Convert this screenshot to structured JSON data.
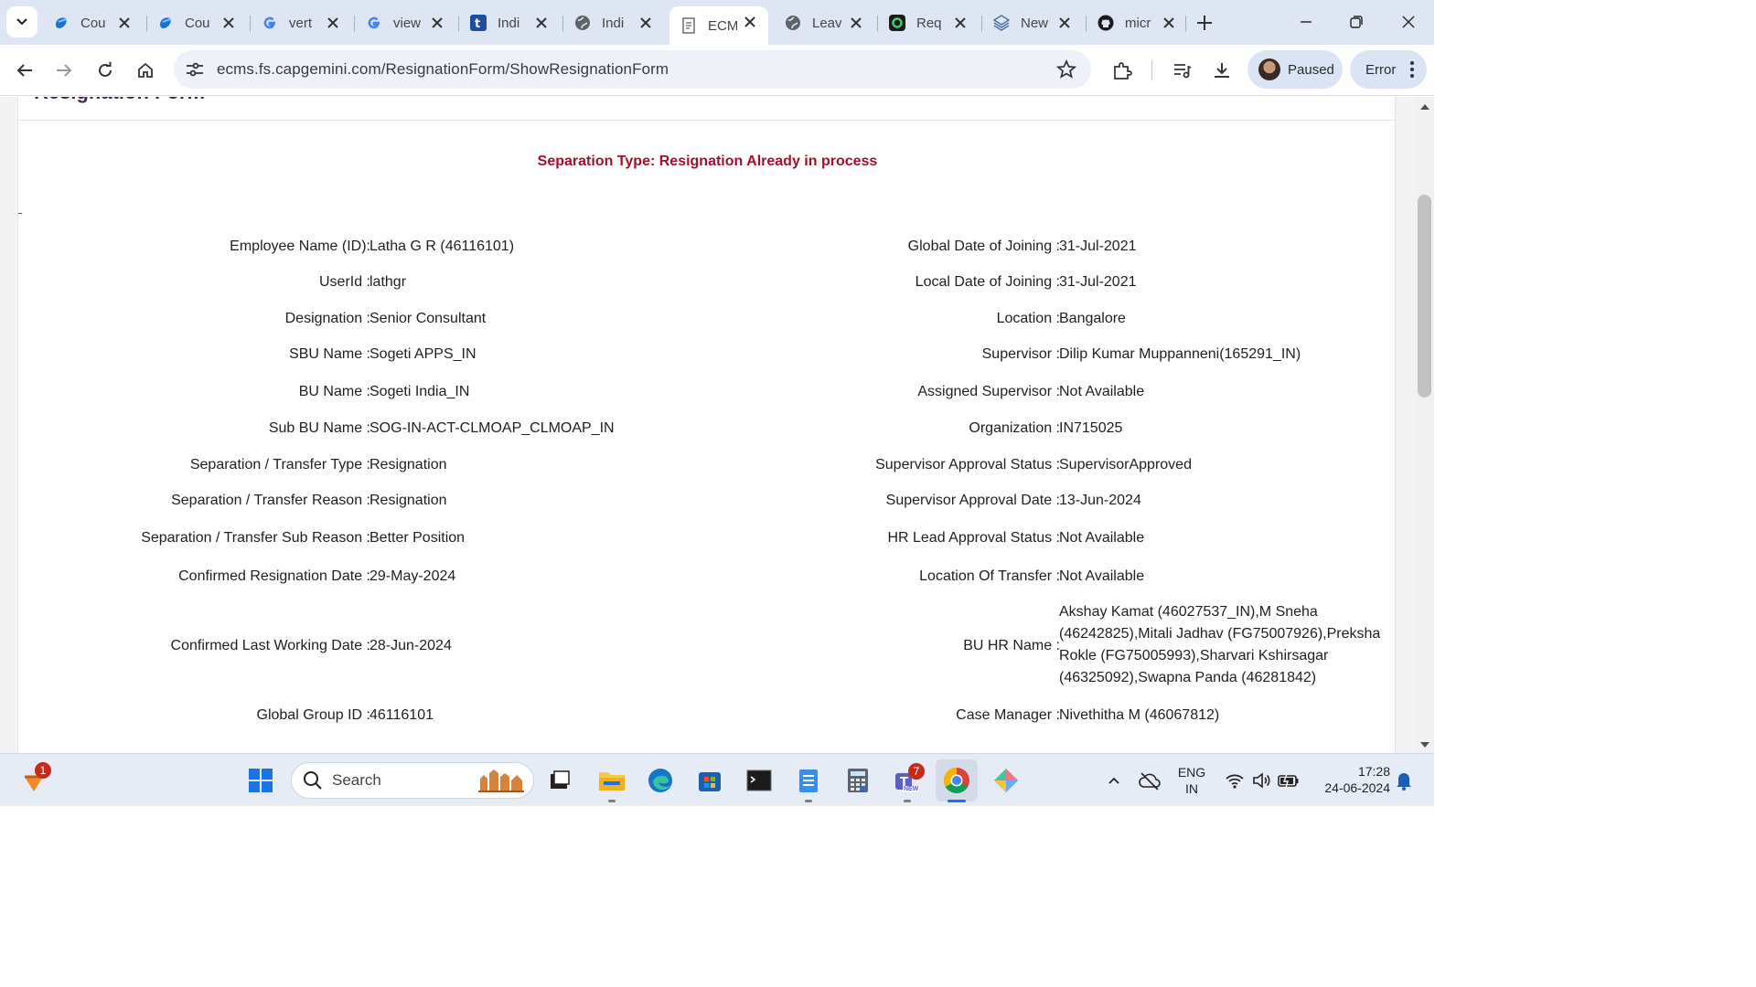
{
  "browser": {
    "tabs": [
      {
        "title": "Cou",
        "icon": "copilot-icon"
      },
      {
        "title": "Cou",
        "icon": "copilot-icon"
      },
      {
        "title": "vert",
        "icon": "google-icon"
      },
      {
        "title": "view",
        "icon": "google-icon"
      },
      {
        "title": "Indi",
        "icon": "t-app-icon"
      },
      {
        "title": "Indi",
        "icon": "globe-icon"
      },
      {
        "title": "ECM",
        "icon": "document-icon",
        "active": true
      },
      {
        "title": "Leav",
        "icon": "globe-icon"
      },
      {
        "title": "Req",
        "icon": "square-app-icon"
      },
      {
        "title": "New",
        "icon": "stack-icon"
      },
      {
        "title": "micr",
        "icon": "github-icon"
      }
    ],
    "url": "ecms.fs.capgemini.com/ResignationForm/ShowResignationForm",
    "profile_label": "Paused",
    "error_label": "Error"
  },
  "page": {
    "heading": "Resignation Form",
    "separation_type": "Separation Type: Resignation Already in process",
    "left_fields": [
      {
        "label": "Employee Name (ID):",
        "value": "Latha G R (46116101)"
      },
      {
        "label": "UserId :",
        "value": "lathgr"
      },
      {
        "label": "Designation :",
        "value": "Senior Consultant"
      },
      {
        "label": "SBU Name :",
        "value": "Sogeti APPS_IN"
      },
      {
        "label": "BU Name :",
        "value": "Sogeti India_IN"
      },
      {
        "label": "Sub BU Name :",
        "value": "SOG-IN-ACT-CLMOAP_CLMOAP_IN"
      },
      {
        "label": "Separation / Transfer Type :",
        "value": "Resignation"
      },
      {
        "label": "Separation / Transfer Reason :",
        "value": "Resignation"
      },
      {
        "label": "Separation / Transfer Sub Reason :",
        "value": "Better Position"
      },
      {
        "label": "Confirmed Resignation Date :",
        "value": "29-May-2024"
      },
      {
        "label": "Confirmed Last Working Date :",
        "value": "28-Jun-2024"
      },
      {
        "label": "Global Group ID :",
        "value": "46116101"
      }
    ],
    "right_fields": [
      {
        "label": "Global Date of Joining :",
        "value": "31-Jul-2021"
      },
      {
        "label": "Local Date of Joining :",
        "value": "31-Jul-2021"
      },
      {
        "label": "Location :",
        "value": "Bangalore"
      },
      {
        "label": "Supervisor :",
        "value": "Dilip Kumar Muppanneni(165291_IN)"
      },
      {
        "label": "Assigned Supervisor :",
        "value": "Not Available"
      },
      {
        "label": "Organization :",
        "value": "IN715025"
      },
      {
        "label": "Supervisor Approval Status :",
        "value": "SupervisorApproved"
      },
      {
        "label": "Supervisor Approval Date :",
        "value": "13-Jun-2024"
      },
      {
        "label": "HR Lead Approval Status :",
        "value": "Not Available"
      },
      {
        "label": "Location Of Transfer :",
        "value": "Not Available"
      },
      {
        "label": "BU HR Name :",
        "value": "Akshay Kamat (46027537_IN),M Sneha (46242825),Mitali Jadhav (FG75007926),Preksha Rokle (FG75005993),Sharvari Kshirsagar (46325092),Swapna Panda (46281842)"
      },
      {
        "label": "Case Manager :",
        "value": "Nivethitha M (46067812)"
      }
    ]
  },
  "taskbar": {
    "search_placeholder": "Search",
    "widgets_badge": "1",
    "teams_badge": "7",
    "teams_tag": "NEW",
    "lang_line1": "ENG",
    "lang_line2": "IN",
    "time": "17:28",
    "date": "24-06-2024"
  },
  "colors": {
    "separation_type": "#a3102a",
    "heading": "#3b2a4d",
    "tabstrip": "#dfe6f3",
    "taskbar": "#e6ecf5"
  }
}
